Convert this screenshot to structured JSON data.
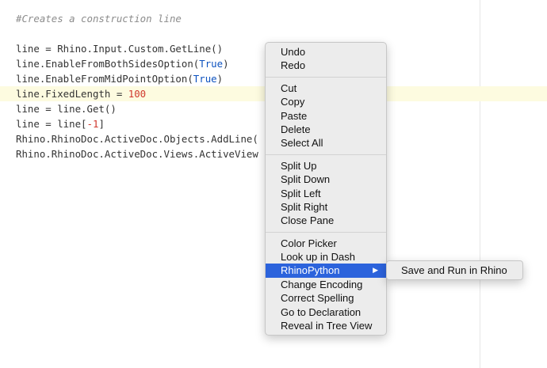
{
  "editor": {
    "lines": [
      {
        "tokens": [
          {
            "t": "#Creates a construction line",
            "c": "comment"
          }
        ]
      },
      {
        "tokens": [
          {
            "t": "",
            "c": ""
          }
        ]
      },
      {
        "tokens": [
          {
            "t": "line = Rhino.Input.Custom.GetLine()",
            "c": ""
          }
        ]
      },
      {
        "tokens": [
          {
            "t": "line.EnableFromBothSidesOption(",
            "c": ""
          },
          {
            "t": "True",
            "c": "const"
          },
          {
            "t": ")",
            "c": ""
          }
        ]
      },
      {
        "tokens": [
          {
            "t": "line.EnableFromMidPointOption(",
            "c": ""
          },
          {
            "t": "True",
            "c": "const"
          },
          {
            "t": ")",
            "c": ""
          }
        ]
      },
      {
        "tokens": [
          {
            "t": "line.FixedLength = ",
            "c": ""
          },
          {
            "t": "100",
            "c": "num"
          }
        ],
        "active": true
      },
      {
        "tokens": [
          {
            "t": "line = line.Get()",
            "c": ""
          }
        ]
      },
      {
        "tokens": [
          {
            "t": "line = line[",
            "c": ""
          },
          {
            "t": "-1",
            "c": "num"
          },
          {
            "t": "]",
            "c": ""
          }
        ]
      },
      {
        "tokens": [
          {
            "t": "Rhino.RhinoDoc.ActiveDoc.Objects.AddLine(",
            "c": ""
          }
        ]
      },
      {
        "tokens": [
          {
            "t": "Rhino.RhinoDoc.ActiveDoc.Views.ActiveView",
            "c": ""
          }
        ]
      }
    ]
  },
  "context_menu": {
    "groups": [
      [
        "Undo",
        "Redo"
      ],
      [
        "Cut",
        "Copy",
        "Paste",
        "Delete",
        "Select All"
      ],
      [
        "Split Up",
        "Split Down",
        "Split Left",
        "Split Right",
        "Close Pane"
      ],
      [
        "Color Picker",
        "Look up in Dash",
        "RhinoPython",
        "Change Encoding",
        "Correct Spelling",
        "Go to Declaration",
        "Reveal in Tree View"
      ]
    ],
    "highlighted": "RhinoPython",
    "submenu_arrow": "▶"
  },
  "submenu": {
    "items": [
      "Save and Run in Rhino"
    ]
  },
  "colors": {
    "highlight": "#2c63dc",
    "active_line": "#fdfbe0",
    "constant": "#0d52bf",
    "number": "#d0372d"
  }
}
